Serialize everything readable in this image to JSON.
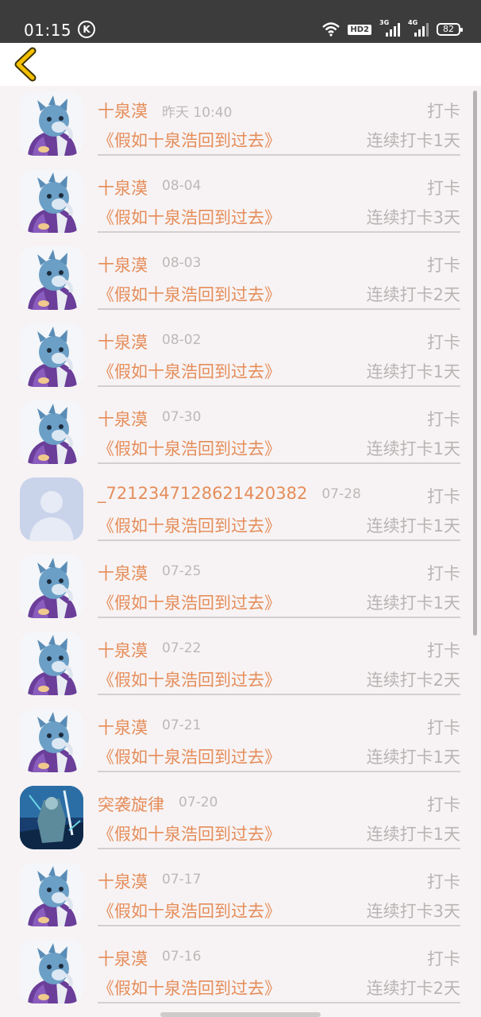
{
  "status_bar": {
    "time": "01:15",
    "k_badge": "K",
    "hd": "HD2",
    "net1": "3G",
    "net2": "4G",
    "battery": "82",
    "icons": [
      "wifi-icon",
      "hd-icon",
      "signal-3g-icon",
      "signal-4g-icon",
      "battery-icon"
    ]
  },
  "header": {
    "back_icon": "chevron-left-icon"
  },
  "colors": {
    "accent": "#e58d5a",
    "muted": "#b9b4b4",
    "divider": "#d4cfcf",
    "back_arrow": "#f3c000"
  },
  "entries": [
    {
      "name": "十泉漠",
      "date": "昨天 10:40",
      "tag": "打卡",
      "book": "《假如十泉浩回到过去》",
      "streak": "连续打卡1天",
      "avatar": "character"
    },
    {
      "name": "十泉漠",
      "date": "08-04",
      "tag": "打卡",
      "book": "《假如十泉浩回到过去》",
      "streak": "连续打卡3天",
      "avatar": "character"
    },
    {
      "name": "十泉漠",
      "date": "08-03",
      "tag": "打卡",
      "book": "《假如十泉浩回到过去》",
      "streak": "连续打卡2天",
      "avatar": "character"
    },
    {
      "name": "十泉漠",
      "date": "08-02",
      "tag": "打卡",
      "book": "《假如十泉浩回到过去》",
      "streak": "连续打卡1天",
      "avatar": "character"
    },
    {
      "name": "十泉漠",
      "date": "07-30",
      "tag": "打卡",
      "book": "《假如十泉浩回到过去》",
      "streak": "连续打卡1天",
      "avatar": "character"
    },
    {
      "name": "_7212347128621420382",
      "date": "07-28",
      "tag": "打卡",
      "book": "《假如十泉浩回到过去》",
      "streak": "连续打卡1天",
      "avatar": "default"
    },
    {
      "name": "十泉漠",
      "date": "07-25",
      "tag": "打卡",
      "book": "《假如十泉浩回到过去》",
      "streak": "连续打卡1天",
      "avatar": "character"
    },
    {
      "name": "十泉漠",
      "date": "07-22",
      "tag": "打卡",
      "book": "《假如十泉浩回到过去》",
      "streak": "连续打卡2天",
      "avatar": "character"
    },
    {
      "name": "十泉漠",
      "date": "07-21",
      "tag": "打卡",
      "book": "《假如十泉浩回到过去》",
      "streak": "连续打卡1天",
      "avatar": "character"
    },
    {
      "name": "突袭旋律",
      "date": "07-20",
      "tag": "打卡",
      "book": "《假如十泉浩回到过去》",
      "streak": "连续打卡1天",
      "avatar": "game"
    },
    {
      "name": "十泉漠",
      "date": "07-17",
      "tag": "打卡",
      "book": "《假如十泉浩回到过去》",
      "streak": "连续打卡3天",
      "avatar": "character"
    },
    {
      "name": "十泉漠",
      "date": "07-16",
      "tag": "打卡",
      "book": "《假如十泉浩回到过去》",
      "streak": "连续打卡2天",
      "avatar": "character"
    }
  ]
}
